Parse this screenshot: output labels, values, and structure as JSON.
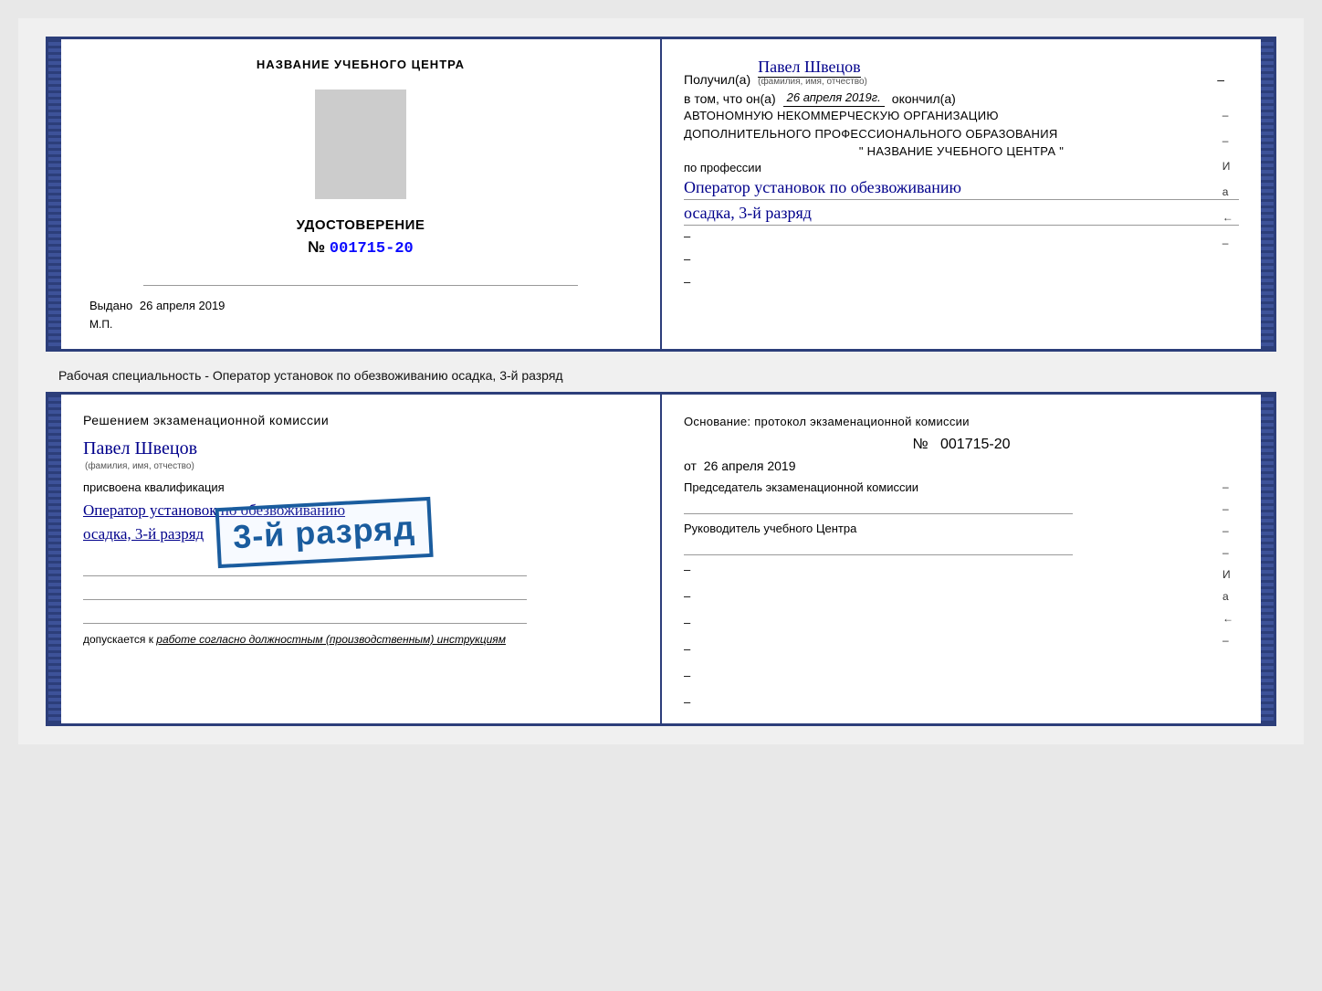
{
  "top_cert": {
    "left": {
      "org_name": "НАЗВАНИЕ УЧЕБНОГО ЦЕНТРА",
      "cert_title": "УДОСТОВЕРЕНИЕ",
      "cert_number_prefix": "№",
      "cert_number": "001715-20",
      "issued_label": "Выдано",
      "issued_date": "26 апреля 2019",
      "mp_label": "М.П."
    },
    "right": {
      "received_prefix": "Получил(а)",
      "received_name": "Павел Швецов",
      "fio_label": "(фамилия, имя, отчество)",
      "dash1": "–",
      "date_prefix": "в том, что он(а)",
      "date_value": "26 апреля 2019г.",
      "date_suffix": "окончил(а)",
      "org_line1": "АВТОНОМНУЮ НЕКОММЕРЧЕСКУЮ ОРГАНИЗАЦИЮ",
      "org_line2": "ДОПОЛНИТЕЛЬНОГО ПРОФЕССИОНАЛЬНОГО ОБРАЗОВАНИЯ",
      "org_line3": "\"   НАЗВАНИЕ УЧЕБНОГО ЦЕНТРА   \"",
      "side_letter_i": "И",
      "side_letter_a": "а",
      "side_symbol": "←",
      "profession_label": "по профессии",
      "profession_value": "Оператор установок по обезвоживанию",
      "speciality_value": "осадка, 3-й разряд"
    }
  },
  "between_label": "Рабочая специальность - Оператор установок по обезвоживанию осадка, 3-й разряд",
  "bottom_cert": {
    "left": {
      "decision_title": "Решением экзаменационной комиссии",
      "person_name": "Павел Швецов",
      "fio_small": "(фамилия, имя, отчество)",
      "assigned_label": "присвоена квалификация",
      "qualification": "Оператор установок по обезвоживанию",
      "speciality": "осадка, 3-й разряд",
      "stamp_text": "3-й разряд",
      "allowed_prefix": "допускается к",
      "allowed_italic": "работе согласно должностным (производственным) инструкциям"
    },
    "right": {
      "basis_text": "Основание: протокол экзаменационной комиссии",
      "protocol_prefix": "№",
      "protocol_number": "001715-20",
      "date_prefix": "от",
      "date_value": "26 апреля 2019",
      "chairman_label": "Председатель экзаменационной комиссии",
      "head_label": "Руководитель учебного Центра",
      "side_letter_i": "И",
      "side_letter_a": "а",
      "side_symbol": "←"
    }
  }
}
